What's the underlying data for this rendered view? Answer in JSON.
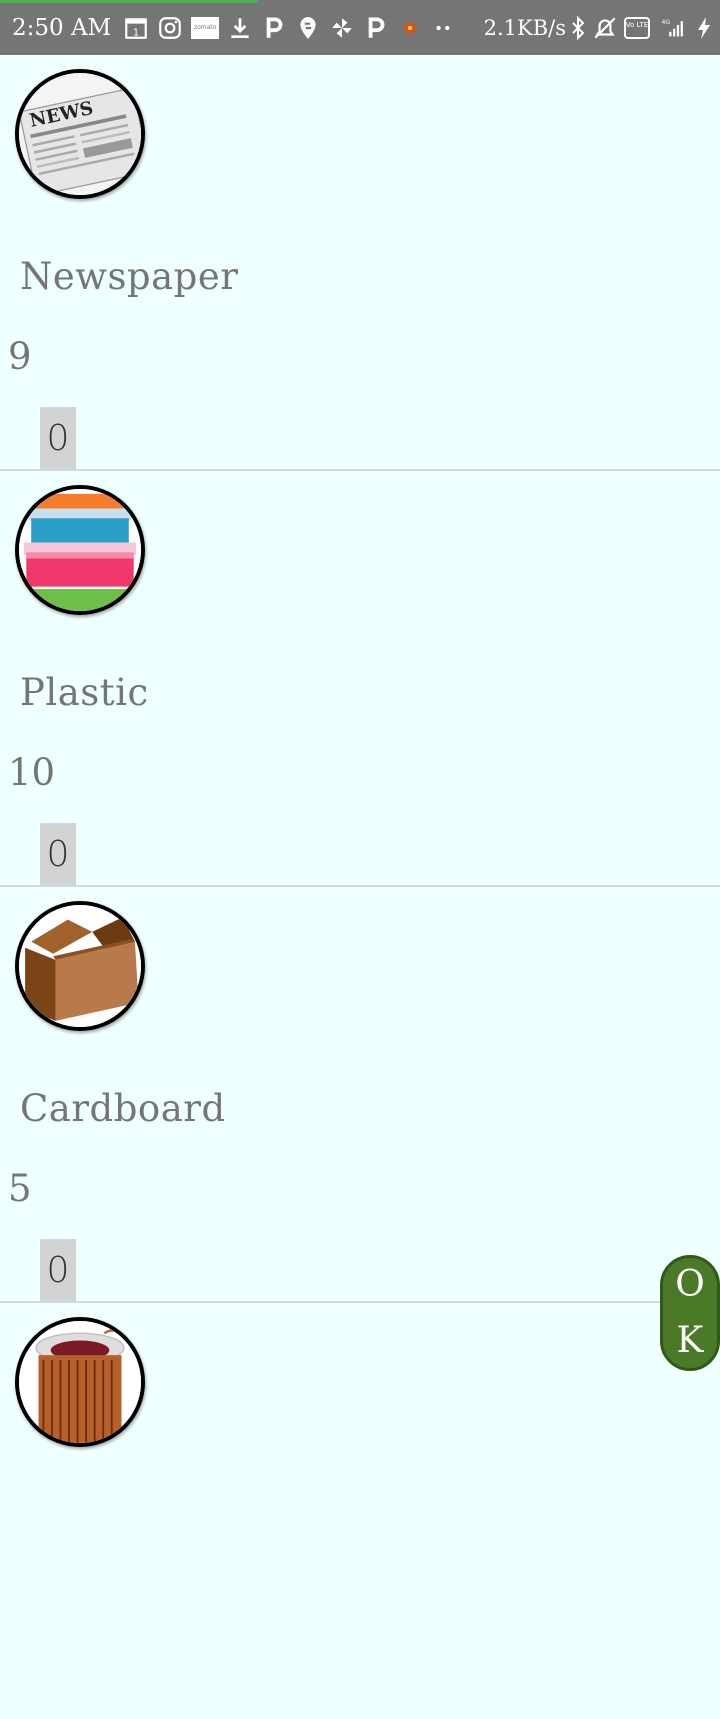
{
  "status_bar": {
    "time": "2:50 AM",
    "zomato_label": "zomato",
    "net_speed": "2.1KB/s",
    "network_label": "4G",
    "volte_label": "Vo LTE",
    "left_icons": [
      "calendar-icon",
      "instagram-icon",
      "zomato-icon",
      "download-icon",
      "paytm-icon",
      "swiggy-icon",
      "pinwheel-icon",
      "paytm-icon",
      "notification-dot-icon",
      "more-icon"
    ],
    "right_icons": [
      "bluetooth-icon",
      "alarm-off-icon",
      "volte-icon",
      "signal-icon",
      "charging-icon"
    ]
  },
  "items": [
    {
      "name": "Newspaper",
      "price": "9",
      "quantity": "0",
      "image": "newspaper-image"
    },
    {
      "name": "Plastic",
      "price": "10",
      "quantity": "0",
      "image": "plastic-containers-image"
    },
    {
      "name": "Cardboard",
      "price": "5",
      "quantity": "0",
      "image": "cardboard-box-image"
    },
    {
      "name": "",
      "price": "",
      "quantity": "",
      "image": "copper-wire-image"
    }
  ],
  "ok_button": {
    "label_line1": "O",
    "label_line2": "K",
    "color": "#4a7a28"
  },
  "colors": {
    "background": "#f0ffff",
    "status_bar": "#757575",
    "qty_box": "#d3d3d3"
  }
}
